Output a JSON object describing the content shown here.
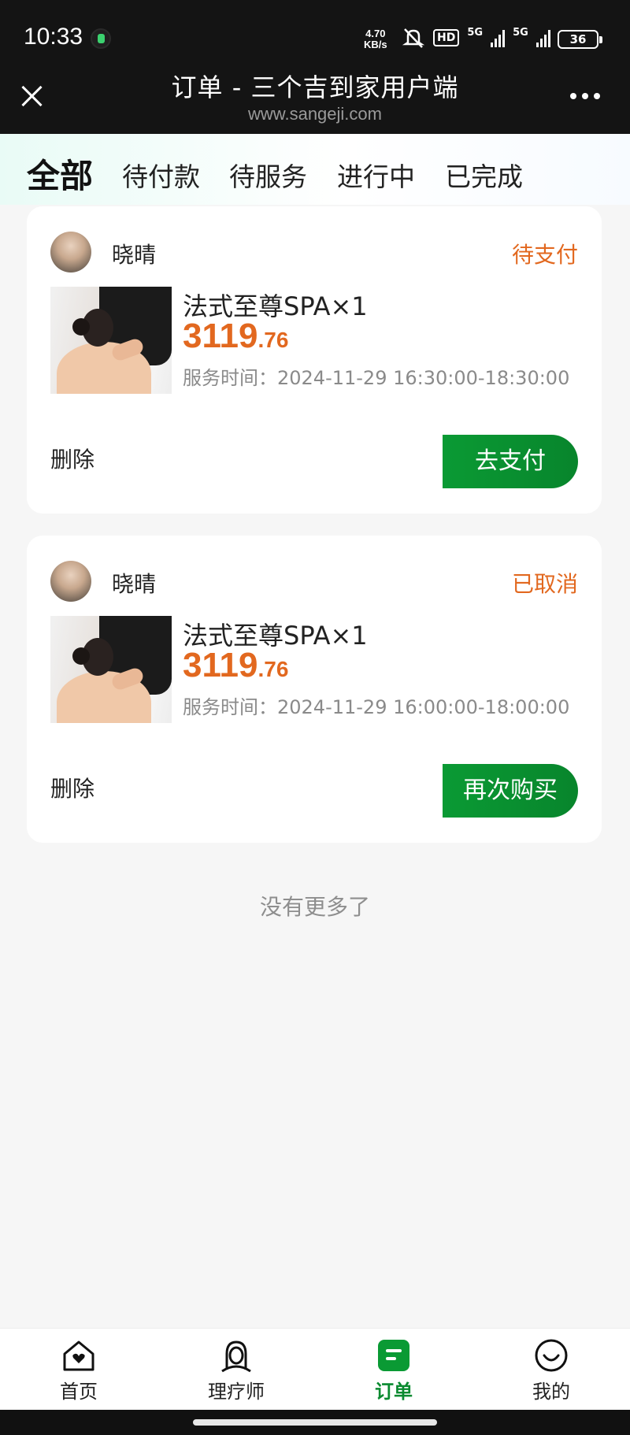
{
  "status_bar": {
    "time": "10:33",
    "net_speed_value": "4.70",
    "net_speed_unit": "KB/s",
    "hd": "HD",
    "network_1": "5G",
    "network_2": "5G",
    "battery": "36"
  },
  "title_bar": {
    "title": "订单 - 三个吉到家用户端",
    "url": "www.sangeji.com"
  },
  "tabs": [
    {
      "label": "全部",
      "active": true
    },
    {
      "label": "待付款",
      "active": false
    },
    {
      "label": "待服务",
      "active": false
    },
    {
      "label": "进行中",
      "active": false
    },
    {
      "label": "已完成",
      "active": false
    }
  ],
  "orders": [
    {
      "seller": "晓晴",
      "status": "待支付",
      "product": "法式至尊SPA×1",
      "price_int": "3119",
      "price_dec": ".76",
      "service_time": "服务时间：2024-11-29 16:30:00-18:30:00",
      "delete_label": "删除",
      "action_label": "去支付"
    },
    {
      "seller": "晓晴",
      "status": "已取消",
      "product": "法式至尊SPA×1",
      "price_int": "3119",
      "price_dec": ".76",
      "service_time": "服务时间：2024-11-29 16:00:00-18:00:00",
      "delete_label": "删除",
      "action_label": "再次购买"
    }
  ],
  "no_more": "没有更多了",
  "bottom_nav": [
    {
      "label": "首页",
      "icon": "home-icon",
      "active": false
    },
    {
      "label": "理疗师",
      "icon": "therapist-icon",
      "active": false
    },
    {
      "label": "订单",
      "icon": "order-icon",
      "active": true
    },
    {
      "label": "我的",
      "icon": "profile-icon",
      "active": false
    }
  ],
  "colors": {
    "accent_green": "#0a9a34",
    "status_orange": "#e2681f"
  }
}
